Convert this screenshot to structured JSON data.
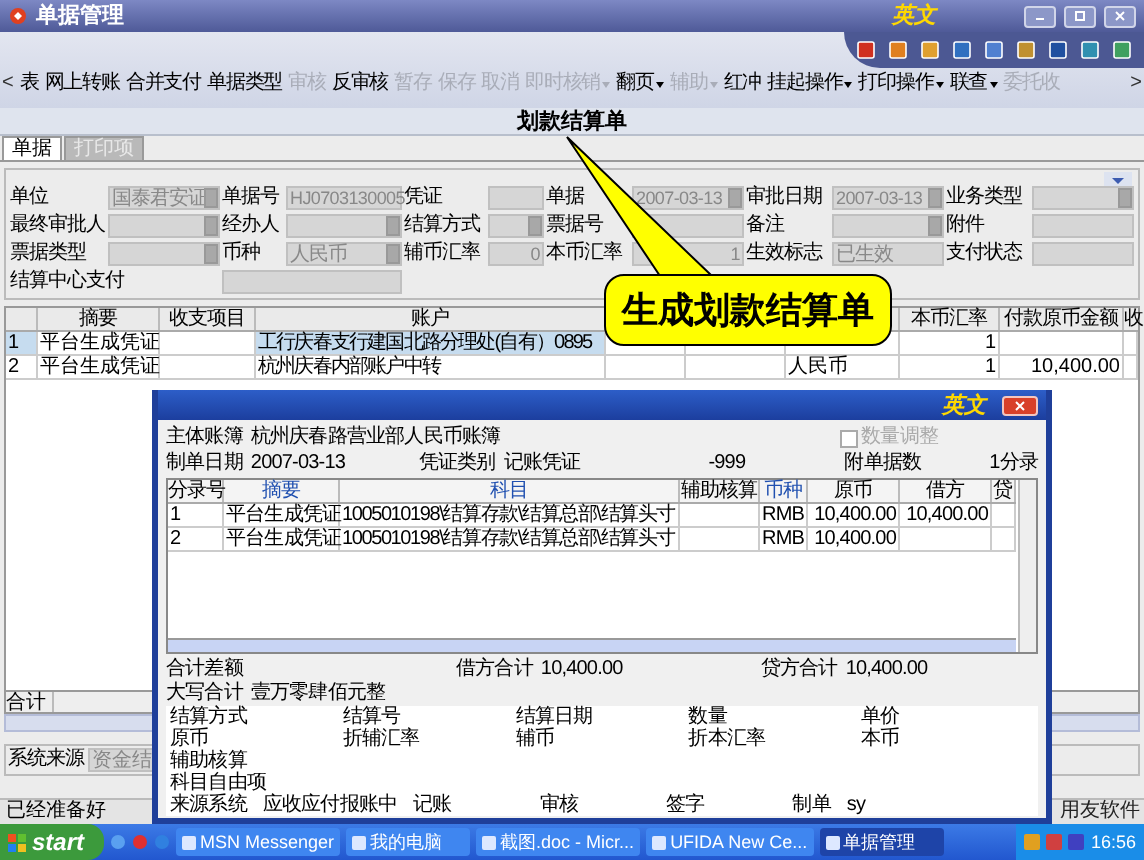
{
  "window": {
    "title": "单据管理",
    "logo": "英文"
  },
  "toolbar": {
    "scroll_left": "<",
    "scroll_right": ">",
    "items": [
      {
        "label": "表",
        "disabled": false,
        "menu": false
      },
      {
        "label": "网上转账",
        "disabled": false,
        "menu": false
      },
      {
        "label": "合并支付",
        "disabled": false,
        "menu": false
      },
      {
        "label": "单据类型",
        "disabled": false,
        "menu": false
      },
      {
        "label": "审核",
        "disabled": true,
        "menu": false
      },
      {
        "label": "反审核",
        "disabled": false,
        "menu": false
      },
      {
        "label": "暂存",
        "disabled": true,
        "menu": false
      },
      {
        "label": "保存",
        "disabled": true,
        "menu": false
      },
      {
        "label": "取消",
        "disabled": true,
        "menu": false
      },
      {
        "label": "即时核销",
        "disabled": true,
        "menu": true
      },
      {
        "label": "翻页",
        "disabled": false,
        "menu": true
      },
      {
        "label": "辅助",
        "disabled": true,
        "menu": true
      },
      {
        "label": "红冲",
        "disabled": false,
        "menu": false
      },
      {
        "label": "挂起操作",
        "disabled": false,
        "menu": true
      },
      {
        "label": "打印操作",
        "disabled": false,
        "menu": true
      },
      {
        "label": "联查",
        "disabled": false,
        "menu": true
      },
      {
        "label": "委托收",
        "disabled": true,
        "menu": false
      }
    ]
  },
  "heading": "划款结算单",
  "tabs": [
    {
      "label": "单据",
      "selected": true
    },
    {
      "label": "打印项",
      "selected": false
    }
  ],
  "form": {
    "rows": [
      [
        {
          "label": "单位",
          "value": "国泰君安证",
          "lookup": true
        },
        {
          "label": "单据号",
          "value": "HJ0703130005",
          "lookup": false
        },
        {
          "label": "凭证",
          "lookup": false
        },
        {
          "label": "单据",
          "value": "2007-03-13",
          "lookup": true
        },
        {
          "label": "审批日期",
          "value": "2007-03-13",
          "lookup": true
        },
        {
          "label": "业务类型",
          "lookup": true
        }
      ],
      [
        {
          "label": "最终审批人",
          "lookup": true
        },
        {
          "label": "经办人",
          "lookup": true
        },
        {
          "label": "结算方式",
          "lookup": true
        },
        {
          "label": "票据号",
          "lookup": false
        },
        {
          "label": "备注",
          "lookup": true
        },
        {
          "label": "附件",
          "lookup": false
        }
      ],
      [
        {
          "label": "票据类型",
          "lookup": true
        },
        {
          "label": "币种",
          "value": "人民币",
          "lookup": true
        },
        {
          "label": "辅币汇率",
          "value": "0",
          "numeric": true,
          "lookup": false
        },
        {
          "label": "本币汇率",
          "value": "1",
          "numeric": true,
          "lookup": false
        },
        {
          "label": "生效标志",
          "value": "已生效",
          "numeric": false,
          "lookup": false
        },
        {
          "label": "支付状态",
          "lookup": false
        }
      ],
      [
        {
          "label": "结算中心支付",
          "lookup": false
        }
      ]
    ]
  },
  "bill_table": {
    "columns": [
      "",
      "摘要",
      "收支项目",
      "账户",
      "",
      "",
      "",
      "本币汇率",
      "付款原币金额",
      "收"
    ],
    "rows": [
      {
        "selected": true,
        "cells": [
          "1",
          "平台生成凭证",
          "",
          "工行庆春支行建国北路分理处(自有）0895",
          "",
          "",
          "",
          "1",
          "",
          ""
        ]
      },
      {
        "selected": false,
        "cells": [
          "2",
          "平台生成凭证",
          "",
          "杭州庆春内部账户中转",
          "",
          "",
          "人民币",
          "1",
          "10,400.00",
          ""
        ]
      }
    ],
    "total_label": "合计"
  },
  "source": {
    "label": "系统来源",
    "value": "资金结"
  },
  "status_bar": {
    "text": "已经准备好",
    "vendor": "用友软件"
  },
  "callout": {
    "text": "生成划款结算单"
  },
  "dialog": {
    "logo": "英文",
    "book_label": "主体账簿",
    "book": "杭州庆春路营业部人民币账簿",
    "quantity_adjust": {
      "label": "数量调整",
      "checked": false,
      "disabled": true
    },
    "date_label": "制单日期",
    "date": "2007-03-13",
    "type_label": "凭证类别",
    "type": "记账凭证",
    "number": "-999",
    "attach_label": "附单据数",
    "entries": "1分录",
    "columns": [
      {
        "label": "分录号",
        "link": false
      },
      {
        "label": "摘要",
        "link": true
      },
      {
        "label": "科目",
        "link": true
      },
      {
        "label": "辅助核算",
        "link": false
      },
      {
        "label": "币种",
        "link": true
      },
      {
        "label": "原币",
        "link": false
      },
      {
        "label": "借方",
        "link": false
      },
      {
        "label": "贷",
        "link": false
      }
    ],
    "rows": [
      {
        "cells": [
          "1",
          "平台生成凭证",
          "1005010198\\结算存款\\结算总部\\结算头寸",
          "",
          "RMB",
          "10,400.00",
          "10,400.00",
          ""
        ]
      },
      {
        "cells": [
          "2",
          "平台生成凭证",
          "1005010198\\结算存款\\结算总部\\结算头寸",
          "",
          "RMB",
          "10,400.00",
          "",
          ""
        ]
      }
    ],
    "diff_label": "合计差额",
    "debit_label": "借方合计",
    "debit": "10,400.00",
    "credit_label": "贷方合计",
    "credit": "10,400.00",
    "caps_label": "大写合计",
    "caps": "壹万零肆佰元整",
    "detail_rows": [
      [
        "结算方式",
        "结算号",
        "结算日期",
        "数量",
        "单价"
      ],
      [
        "原币",
        "折辅汇率",
        "辅币",
        "折本汇率",
        "本币"
      ],
      [
        "辅助核算"
      ],
      [
        "科目自由项"
      ]
    ],
    "footer": [
      "来源系统",
      "应收应付报账中",
      "记账",
      "审核",
      "签字",
      "制单",
      "sy"
    ]
  },
  "taskbar": {
    "start": "start",
    "tasks": [
      {
        "label": "MSN Messenger",
        "selected": false
      },
      {
        "label": "我的电脑",
        "selected": false
      },
      {
        "label": "截图.doc - Micr...",
        "selected": false
      },
      {
        "label": "UFIDA New Ce...",
        "selected": false
      },
      {
        "label": "单据管理",
        "selected": true
      }
    ],
    "clock": "16:56"
  }
}
